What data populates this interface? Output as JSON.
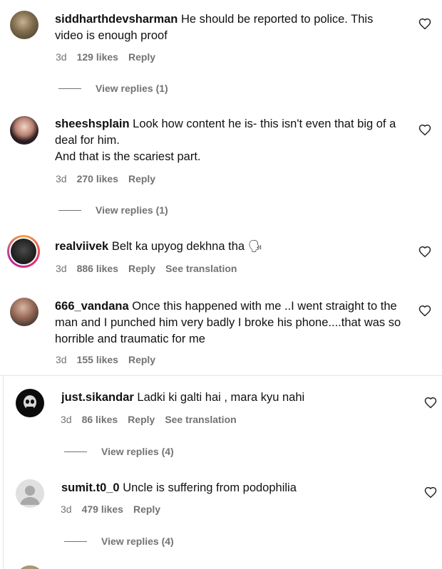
{
  "comments": [
    {
      "username": "siddharthdevsharman",
      "text": "He should be reported to police. This video is enough proof",
      "time": "3d",
      "likes": "129 likes",
      "reply": "Reply",
      "view_replies": "View replies (1)"
    },
    {
      "username": "sheeshsplain",
      "text": "Look how content he is- this isn't even that big of a deal for him.",
      "text2": "And that is the scariest part.",
      "time": "3d",
      "likes": "270 likes",
      "reply": "Reply",
      "view_replies": "View replies (1)"
    },
    {
      "username": "realviivek",
      "text": "Belt ka upyog dekhna tha 🗣",
      "time": "3d",
      "likes": "886 likes",
      "reply": "Reply",
      "see_translation": "See translation"
    },
    {
      "username": "666_vandana",
      "text": "Once this happened with me ..I went straight to the man and I punched him very badly I broke his phone....that was so horrible and traumatic for me",
      "time": "3d",
      "likes": "155 likes",
      "reply": "Reply"
    },
    {
      "username": "just.sikandar",
      "text": "Ladki ki galti hai , mara kyu nahi",
      "time": "3d",
      "likes": "86 likes",
      "reply": "Reply",
      "see_translation": "See translation",
      "view_replies": "View replies (4)"
    },
    {
      "username": "sumit.t0_0",
      "text": "Uncle is suffering from podophilia",
      "time": "3d",
      "likes": "479 likes",
      "reply": "Reply",
      "view_replies": "View replies (4)"
    }
  ],
  "icons": {
    "heart": "heart-outline-icon",
    "default_avatar": "default-avatar-icon"
  },
  "colors": {
    "text": "#111111",
    "muted": "#737373",
    "story_ring": "#e8306b"
  }
}
